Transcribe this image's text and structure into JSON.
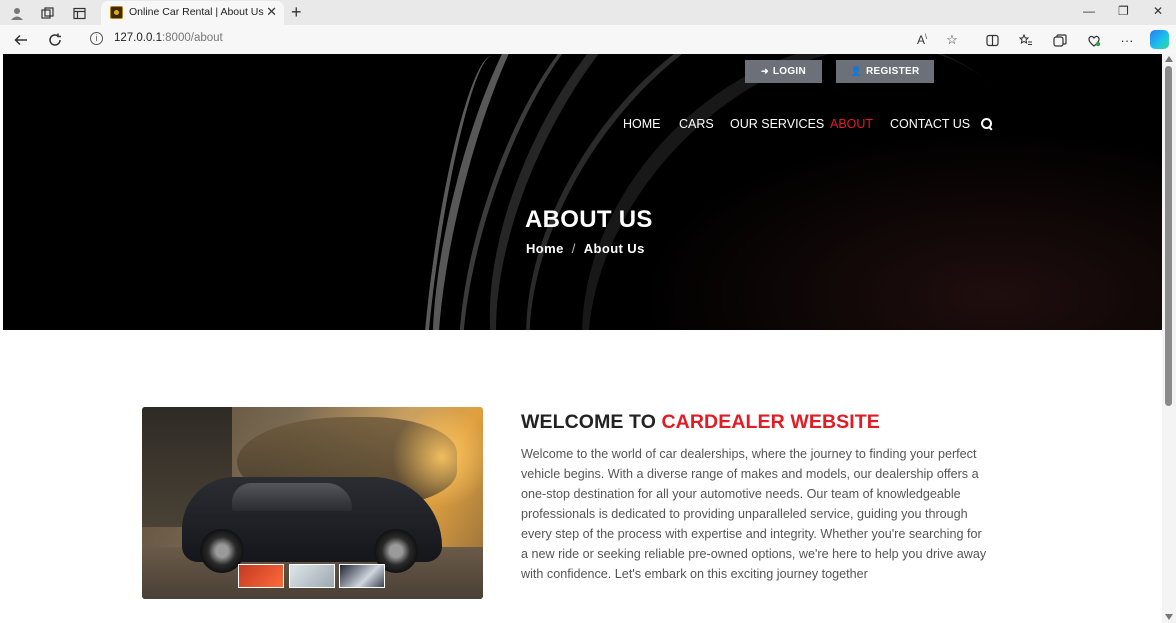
{
  "browser": {
    "tab_title": "Online Car Rental | About Us",
    "url_host": "127.0.0.1",
    "url_path": ":8000/about"
  },
  "header": {
    "login_label": "LOGIN",
    "register_label": "REGISTER",
    "nav": [
      {
        "label": "HOME",
        "active": false
      },
      {
        "label": "CARS",
        "active": false
      },
      {
        "label": "OUR SERVICES",
        "active": false
      },
      {
        "label": "ABOUT",
        "active": true
      },
      {
        "label": "CONTACT US",
        "active": false
      }
    ]
  },
  "hero": {
    "title": "ABOUT US",
    "breadcrumb_home": "Home",
    "breadcrumb_separator": "/",
    "breadcrumb_current": "About Us"
  },
  "about": {
    "heading_prefix": "WELCOME TO ",
    "heading_highlight": "CARDEALER WEBSITE",
    "body": "Welcome to the world of car dealerships, where the journey to finding your perfect vehicle begins. With a diverse range of makes and models, our dealership offers a one-stop destination for all your automotive needs. Our team of knowledgeable professionals is dedicated to providing unparalleled service, guiding you through every step of the process with expertise and integrity. Whether you're searching for a new ride or seeking reliable pre-owned options, we're here to help you drive away with confidence. Let's embark on this exciting journey together"
  },
  "colors": {
    "accent": "#e31b23",
    "hero_bg": "#000000",
    "button_bg": "#6b7079"
  }
}
